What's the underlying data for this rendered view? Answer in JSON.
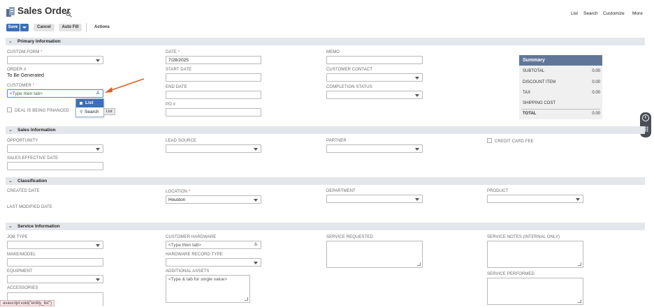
{
  "header": {
    "title": "Sales Order",
    "nav": [
      "List",
      "Search",
      "Customize",
      "More"
    ]
  },
  "toolbar": {
    "save": "Save",
    "cancel": "Cancel",
    "autofill": "Auto Fill",
    "actions": "Actions"
  },
  "colors": {
    "accent": "#3b6fb6",
    "section_bg": "#e3e6ea",
    "summary_header": "#607799",
    "arrow": "#e05d2c"
  },
  "primary": {
    "section_title": "Primary Information",
    "custom_form_label": "CUSTOM FORM",
    "order_label": "ORDER #",
    "order_value": "To Be Generated",
    "customer_label": "CUSTOMER",
    "customer_placeholder": "<Type then tab>",
    "deal_financed_label": "DEAL IS BEING FINANCED",
    "date_label": "DATE",
    "date_value": "7/28/2025",
    "start_date_label": "START DATE",
    "end_date_label": "END DATE",
    "po_label": "PO #",
    "memo_label": "MEMO",
    "customer_contact_label": "CUSTOMER CONTACT",
    "completion_status_label": "COMPLETION STATUS"
  },
  "customer_dropdown": {
    "list": "List",
    "search": "Search",
    "tooltip": "List"
  },
  "summary": {
    "title": "Summary",
    "rows": [
      {
        "label": "SUBTOTAL",
        "value": "0.00"
      },
      {
        "label": "DISCOUNT ITEM",
        "value": "0.00"
      },
      {
        "label": "TAX",
        "value": "0.00"
      },
      {
        "label": "SHIPPING COST",
        "value": ""
      }
    ],
    "total_label": "TOTAL",
    "total_value": "0.00"
  },
  "sales": {
    "section_title": "Sales Information",
    "opportunity_label": "OPPORTUNITY",
    "lead_source_label": "LEAD SOURCE",
    "partner_label": "PARTNER",
    "credit_card_fee_label": "CREDIT CARD FEE",
    "sales_effective_date_label": "SALES EFFECTIVE DATE"
  },
  "classification": {
    "section_title": "Classification",
    "created_date_label": "CREATED DATE",
    "location_label": "LOCATION",
    "location_value": "Houston",
    "department_label": "DEPARTMENT",
    "product_label": "PRODUCT",
    "last_modified_label": "LAST MODIFIED DATE"
  },
  "service": {
    "section_title": "Service Information",
    "job_type_label": "JOB TYPE",
    "customer_hardware_label": "CUSTOMER HARDWARE",
    "customer_hardware_placeholder": "<Type then tab>",
    "service_requested_label": "SERVICE REQUESTED",
    "service_notes_label": "SERVICE NOTES (INTERNAL ONLY)",
    "make_model_label": "MAKE/MODEL",
    "hardware_record_type_label": "HARDWARE RECORD TYPE",
    "equipment_label": "EQUIPMENT",
    "additional_assets_label": "ADDITIONAL ASSETS",
    "additional_assets_placeholder": "<Type & tab for single value>",
    "service_performed_label": "SERVICE PERFORMED",
    "accessories_label": "ACCESSORIES"
  },
  "status_bar": "avascript:void(\"entity_list\")"
}
